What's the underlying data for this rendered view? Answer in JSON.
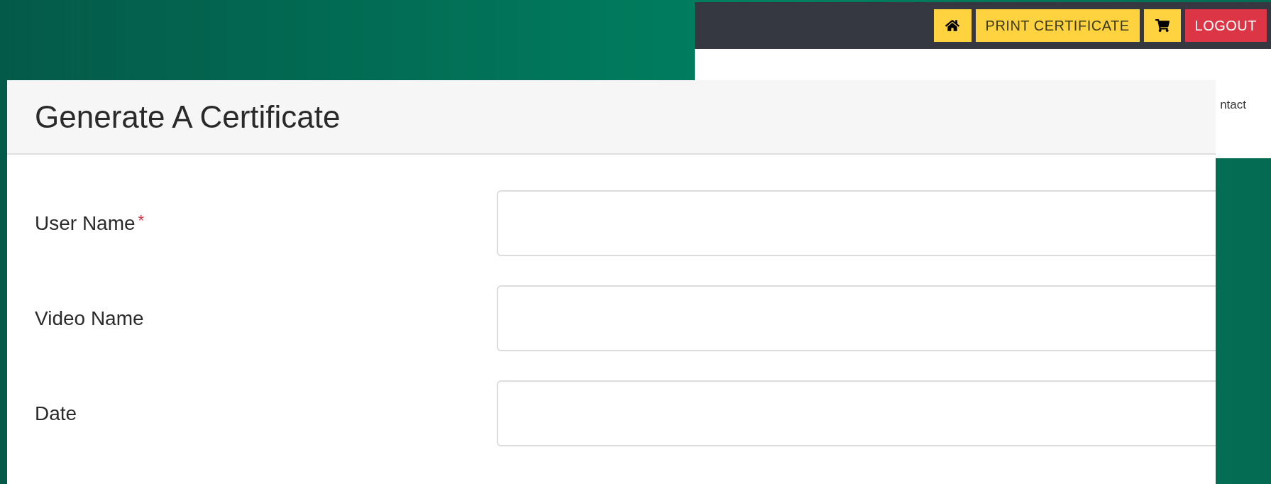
{
  "navbar": {
    "buttons": [
      {
        "kind": "home"
      },
      {
        "kind": "text",
        "label": "PRINT CERTIFICATE",
        "color": "#ffd23f"
      },
      {
        "kind": "cart"
      },
      {
        "kind": "text",
        "label": "LOGOUT",
        "color": "#dc3545"
      }
    ]
  },
  "page_menu": {
    "partial_link": "ntact"
  },
  "dialog": {
    "title": "Generate A Certificate",
    "required_mark": "*",
    "fields": [
      {
        "label": "User Name",
        "required": true
      },
      {
        "label": "Video Name",
        "required": false
      },
      {
        "label": "Date",
        "required": false
      }
    ]
  }
}
